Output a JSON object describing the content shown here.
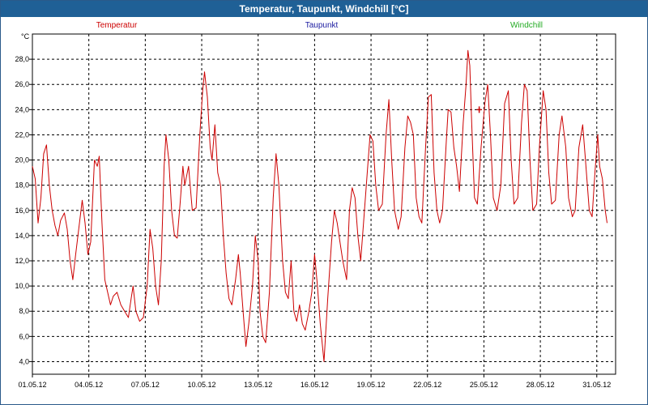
{
  "window": {
    "title": "Temperatur, Taupunkt, Windchill [°C]"
  },
  "colors": {
    "temperature": "#cc0000",
    "dewpoint": "#1a1aa0",
    "windchill": "#22aa22",
    "grid": "#000000",
    "titlebar": "#1f6096"
  },
  "chart_data": {
    "type": "line",
    "title": "Temperatur, Taupunkt, Windchill [°C]",
    "ylabel": "°C",
    "xlabel": "",
    "ylim": [
      3.0,
      30.0
    ],
    "xlim": [
      "01.05.12",
      "01.06.12"
    ],
    "y_ticks": [
      "4,0",
      "6,0",
      "8,0",
      "10,0",
      "12,0",
      "14,0",
      "16,0",
      "18,0",
      "20,0",
      "22,0",
      "24,0",
      "26,0",
      "28,0"
    ],
    "x_ticks": [
      "01.05.12",
      "04.05.12",
      "07.05.12",
      "10.05.12",
      "13.05.12",
      "16.05.12",
      "19.05.12",
      "22.05.12",
      "25.05.12",
      "28.05.12",
      "31.05.12"
    ],
    "grid": true,
    "legend": [
      "Temperatur",
      "Taupunkt",
      "Windchill"
    ],
    "series": [
      {
        "name": "Temperatur",
        "x_unit": "days since 01.05.12",
        "points": [
          [
            0.0,
            19.5
          ],
          [
            0.15,
            18.5
          ],
          [
            0.3,
            15.0
          ],
          [
            0.45,
            17.0
          ],
          [
            0.6,
            20.5
          ],
          [
            0.75,
            21.2
          ],
          [
            0.9,
            18.0
          ],
          [
            1.05,
            16.0
          ],
          [
            1.2,
            14.8
          ],
          [
            1.35,
            14.0
          ],
          [
            1.5,
            15.2
          ],
          [
            1.7,
            15.8
          ],
          [
            1.85,
            14.5
          ],
          [
            2.0,
            12.0
          ],
          [
            2.15,
            10.5
          ],
          [
            2.3,
            12.5
          ],
          [
            2.5,
            15.0
          ],
          [
            2.65,
            16.8
          ],
          [
            2.8,
            15.0
          ],
          [
            2.95,
            12.5
          ],
          [
            3.1,
            13.5
          ],
          [
            3.3,
            20.0
          ],
          [
            3.45,
            19.5
          ],
          [
            3.55,
            20.3
          ],
          [
            3.7,
            15.0
          ],
          [
            3.85,
            10.5
          ],
          [
            4.0,
            9.5
          ],
          [
            4.15,
            8.5
          ],
          [
            4.3,
            9.2
          ],
          [
            4.5,
            9.5
          ],
          [
            4.7,
            8.5
          ],
          [
            4.9,
            8.0
          ],
          [
            5.1,
            7.5
          ],
          [
            5.25,
            9.0
          ],
          [
            5.35,
            10.0
          ],
          [
            5.5,
            8.0
          ],
          [
            5.7,
            7.2
          ],
          [
            5.9,
            7.5
          ],
          [
            6.1,
            10.0
          ],
          [
            6.25,
            14.5
          ],
          [
            6.4,
            13.0
          ],
          [
            6.55,
            10.0
          ],
          [
            6.7,
            8.5
          ],
          [
            6.85,
            12.0
          ],
          [
            7.0,
            19.5
          ],
          [
            7.1,
            22.0
          ],
          [
            7.25,
            20.0
          ],
          [
            7.4,
            16.0
          ],
          [
            7.55,
            14.0
          ],
          [
            7.7,
            13.8
          ],
          [
            7.85,
            16.5
          ],
          [
            8.0,
            19.5
          ],
          [
            8.1,
            18.0
          ],
          [
            8.3,
            19.5
          ],
          [
            8.5,
            16.0
          ],
          [
            8.7,
            16.2
          ],
          [
            8.9,
            22.0
          ],
          [
            9.05,
            25.5
          ],
          [
            9.15,
            27.0
          ],
          [
            9.3,
            25.0
          ],
          [
            9.45,
            21.0
          ],
          [
            9.55,
            20.0
          ],
          [
            9.7,
            22.8
          ],
          [
            9.85,
            19.0
          ],
          [
            10.0,
            18.0
          ],
          [
            10.15,
            14.0
          ],
          [
            10.3,
            11.0
          ],
          [
            10.45,
            9.0
          ],
          [
            10.6,
            8.5
          ],
          [
            10.8,
            10.5
          ],
          [
            10.95,
            12.5
          ],
          [
            11.05,
            11.0
          ],
          [
            11.2,
            8.0
          ],
          [
            11.35,
            5.2
          ],
          [
            11.5,
            7.0
          ],
          [
            11.7,
            10.0
          ],
          [
            11.85,
            14.0
          ],
          [
            12.0,
            12.0
          ],
          [
            12.1,
            8.0
          ],
          [
            12.25,
            6.0
          ],
          [
            12.4,
            5.5
          ],
          [
            12.6,
            9.5
          ],
          [
            12.8,
            17.0
          ],
          [
            12.95,
            20.5
          ],
          [
            13.1,
            18.0
          ],
          [
            13.3,
            12.0
          ],
          [
            13.45,
            9.5
          ],
          [
            13.6,
            9.0
          ],
          [
            13.75,
            12.0
          ],
          [
            13.9,
            8.0
          ],
          [
            14.05,
            7.2
          ],
          [
            14.2,
            8.5
          ],
          [
            14.35,
            7.0
          ],
          [
            14.5,
            6.5
          ],
          [
            14.7,
            8.0
          ],
          [
            14.85,
            9.5
          ],
          [
            15.0,
            12.5
          ],
          [
            15.15,
            10.0
          ],
          [
            15.3,
            7.0
          ],
          [
            15.5,
            4.0
          ],
          [
            15.7,
            9.0
          ],
          [
            15.9,
            13.5
          ],
          [
            16.05,
            16.0
          ],
          [
            16.2,
            15.0
          ],
          [
            16.35,
            13.5
          ],
          [
            16.5,
            12.0
          ],
          [
            16.7,
            10.5
          ],
          [
            16.85,
            16.0
          ],
          [
            17.0,
            17.8
          ],
          [
            17.15,
            17.0
          ],
          [
            17.3,
            14.0
          ],
          [
            17.45,
            12.0
          ],
          [
            17.6,
            15.0
          ],
          [
            17.8,
            19.0
          ],
          [
            17.95,
            22.0
          ],
          [
            18.1,
            21.5
          ],
          [
            18.25,
            18.0
          ],
          [
            18.4,
            16.0
          ],
          [
            18.6,
            16.5
          ],
          [
            18.8,
            22.0
          ],
          [
            18.95,
            24.8
          ],
          [
            19.1,
            20.0
          ],
          [
            19.25,
            16.0
          ],
          [
            19.45,
            14.5
          ],
          [
            19.6,
            15.5
          ],
          [
            19.8,
            21.0
          ],
          [
            19.95,
            23.5
          ],
          [
            20.1,
            23.0
          ],
          [
            20.25,
            22.0
          ],
          [
            20.4,
            17.0
          ],
          [
            20.55,
            15.5
          ],
          [
            20.7,
            15.0
          ],
          [
            20.9,
            21.0
          ],
          [
            21.05,
            25.0
          ],
          [
            21.2,
            25.2
          ],
          [
            21.35,
            19.0
          ],
          [
            21.5,
            16.0
          ],
          [
            21.65,
            15.0
          ],
          [
            21.8,
            16.0
          ],
          [
            22.0,
            21.5
          ],
          [
            22.1,
            24.0
          ],
          [
            22.25,
            23.8
          ],
          [
            22.4,
            21.0
          ],
          [
            22.55,
            19.5
          ],
          [
            22.7,
            17.5
          ],
          [
            22.9,
            23.0
          ],
          [
            23.05,
            26.0
          ],
          [
            23.15,
            28.7
          ],
          [
            23.25,
            27.5
          ],
          [
            23.35,
            23.0
          ],
          [
            23.5,
            17.0
          ],
          [
            23.65,
            16.5
          ],
          [
            23.85,
            21.0
          ],
          [
            24.05,
            24.5
          ],
          [
            24.2,
            26.0
          ],
          [
            24.35,
            22.0
          ],
          [
            24.5,
            17.0
          ],
          [
            24.7,
            16.0
          ],
          [
            24.9,
            18.0
          ],
          [
            25.1,
            24.5
          ],
          [
            25.3,
            25.5
          ],
          [
            25.45,
            20.0
          ],
          [
            25.6,
            16.5
          ],
          [
            25.8,
            17.0
          ],
          [
            26.0,
            23.0
          ],
          [
            26.15,
            26.0
          ],
          [
            26.3,
            25.5
          ],
          [
            26.45,
            20.0
          ],
          [
            26.6,
            16.0
          ],
          [
            26.8,
            16.5
          ],
          [
            26.95,
            21.0
          ],
          [
            27.15,
            25.5
          ],
          [
            27.3,
            24.0
          ],
          [
            27.45,
            19.0
          ],
          [
            27.6,
            16.5
          ],
          [
            27.8,
            16.8
          ],
          [
            28.0,
            22.0
          ],
          [
            28.15,
            23.5
          ],
          [
            28.35,
            21.0
          ],
          [
            28.5,
            17.0
          ],
          [
            28.7,
            15.5
          ],
          [
            28.85,
            16.0
          ],
          [
            29.05,
            21.0
          ],
          [
            29.25,
            22.8
          ],
          [
            29.4,
            20.0
          ],
          [
            29.6,
            16.0
          ],
          [
            29.75,
            15.5
          ],
          [
            29.9,
            19.0
          ],
          [
            30.05,
            22.0
          ],
          [
            30.15,
            19.5
          ],
          [
            30.3,
            18.5
          ],
          [
            30.45,
            16.0
          ],
          [
            30.55,
            15.0
          ]
        ]
      },
      {
        "name": "Taupunkt",
        "points": []
      },
      {
        "name": "Windchill",
        "points": []
      }
    ]
  }
}
